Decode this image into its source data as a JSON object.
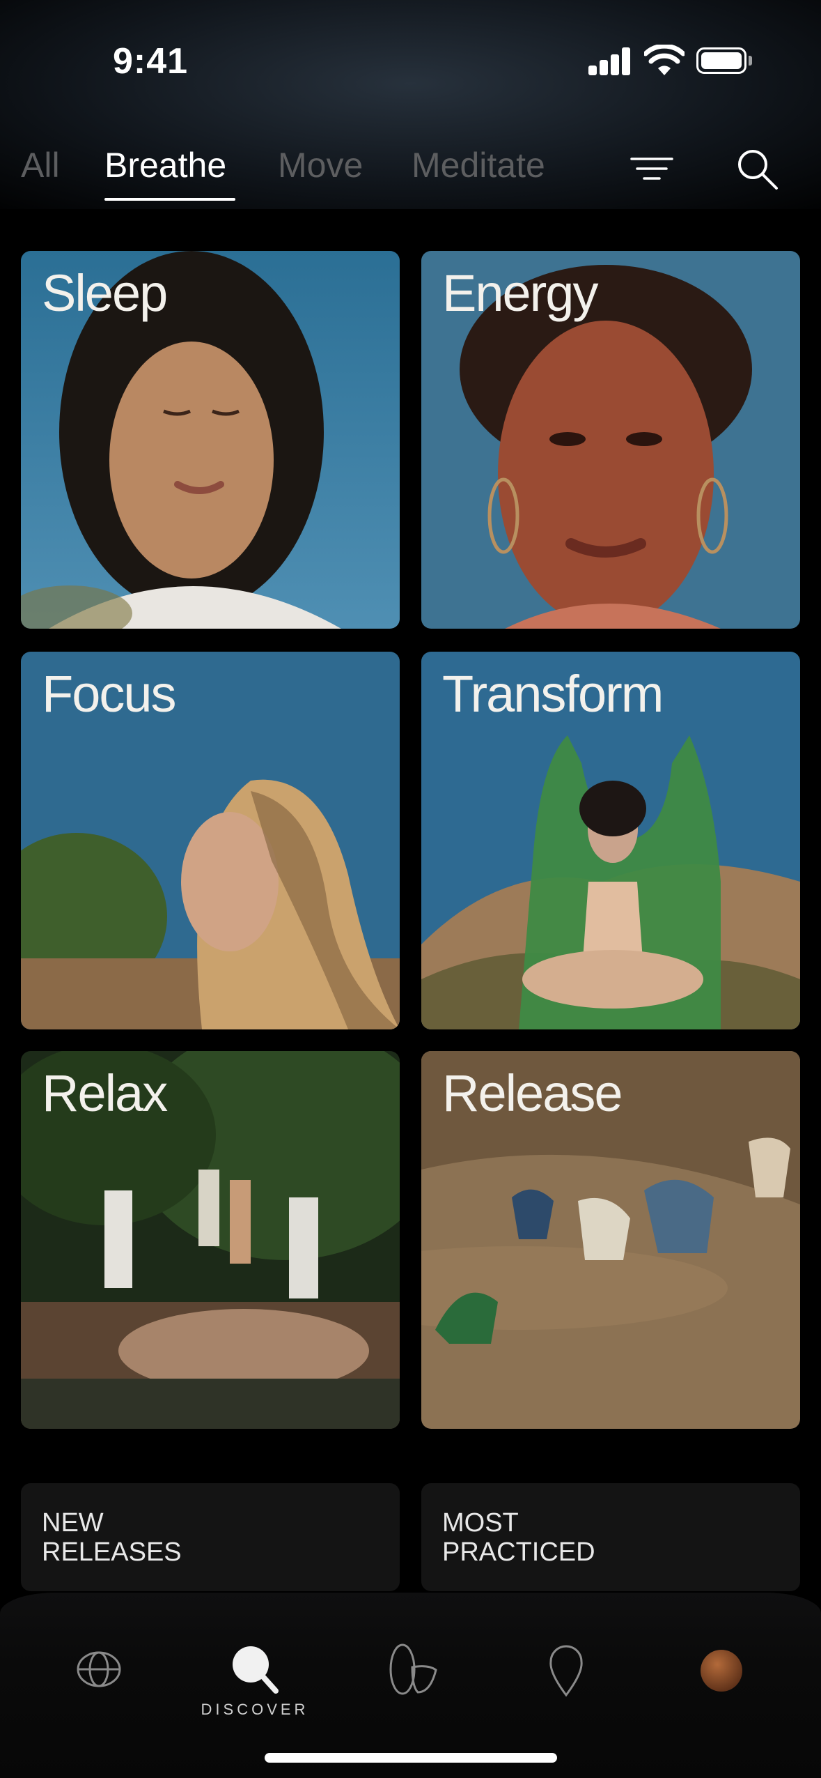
{
  "status_bar": {
    "time": "9:41"
  },
  "tabs": [
    {
      "label": "All",
      "active": false
    },
    {
      "label": "Breathe",
      "active": true
    },
    {
      "label": "Move",
      "active": false
    },
    {
      "label": "Meditate",
      "active": false
    }
  ],
  "toolbar": {
    "filter_icon": "filter-icon",
    "search_icon": "search-icon"
  },
  "categories": [
    {
      "label": "Sleep"
    },
    {
      "label": "Energy"
    },
    {
      "label": "Focus"
    },
    {
      "label": "Transform"
    },
    {
      "label": "Relax"
    },
    {
      "label": "Release"
    }
  ],
  "lists": [
    {
      "label": "NEW\nRELEASES"
    },
    {
      "label": "MOST\nPRACTICED"
    }
  ],
  "bottom_nav": {
    "items": [
      "globe-icon",
      "discover-search-icon",
      "practice-icon",
      "location-pin-icon",
      "profile-avatar"
    ],
    "active_label": "DISCOVER"
  },
  "colors": {
    "background": "#000000",
    "tab_inactive": "#5d5e60",
    "card_dark": "#141414"
  }
}
